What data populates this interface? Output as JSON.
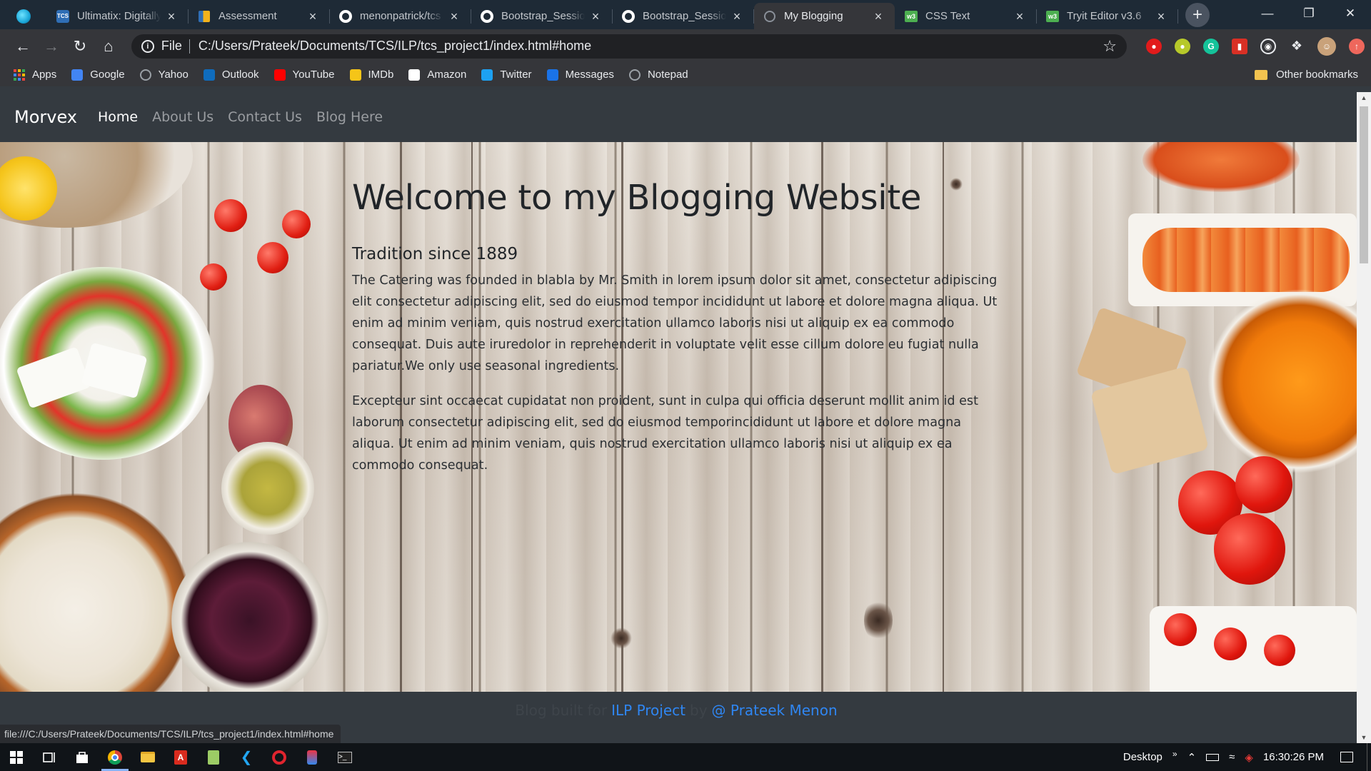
{
  "browser": {
    "tabs": [
      {
        "title": "Ultimatix: Digitally",
        "favicon": "ultimatix-icon",
        "active": false
      },
      {
        "title": "Assessment",
        "favicon": "assessment-icon",
        "active": false
      },
      {
        "title": "menonpatrick/tcs",
        "favicon": "github-icon",
        "active": false
      },
      {
        "title": "Bootstrap_Session",
        "favicon": "github-icon",
        "active": false
      },
      {
        "title": "Bootstrap_Session",
        "favicon": "github-icon",
        "active": false
      },
      {
        "title": "My Blogging",
        "favicon": "globe-icon",
        "active": true
      },
      {
        "title": "CSS Text",
        "favicon": "w3schools-icon",
        "active": false
      },
      {
        "title": "Tryit Editor v3.6",
        "favicon": "w3schools-icon",
        "active": false
      }
    ],
    "address": {
      "scheme_label": "File",
      "url": "C:/Users/Prateek/Documents/TCS/ILP/tcs_project1/index.html#home"
    },
    "bookmarks": [
      {
        "label": "Apps",
        "icon": "apps-grid-icon",
        "color": "#e8453c"
      },
      {
        "label": "Google",
        "icon": "google-icon",
        "color": "#4285f4"
      },
      {
        "label": "Yahoo",
        "icon": "globe-icon",
        "color": "#9aa0a6"
      },
      {
        "label": "Outlook",
        "icon": "outlook-icon",
        "color": "#0f6cbd"
      },
      {
        "label": "YouTube",
        "icon": "youtube-icon",
        "color": "#ff0000"
      },
      {
        "label": "IMDb",
        "icon": "imdb-icon",
        "color": "#f5c518"
      },
      {
        "label": "Amazon",
        "icon": "amazon-icon",
        "color": "#ffffff"
      },
      {
        "label": "Twitter",
        "icon": "twitter-icon",
        "color": "#1da1f2"
      },
      {
        "label": "Messages",
        "icon": "messages-icon",
        "color": "#1a73e8"
      },
      {
        "label": "Notepad",
        "icon": "globe-icon",
        "color": "#9aa0a6"
      }
    ],
    "other_bookmarks": "Other bookmarks",
    "status_url": "file:///C:/Users/Prateek/Documents/TCS/ILP/tcs_project1/index.html#home"
  },
  "site": {
    "brand": "Morvex",
    "nav": [
      {
        "label": "Home",
        "active": true
      },
      {
        "label": "About Us",
        "active": false
      },
      {
        "label": "Contact Us",
        "active": false
      },
      {
        "label": "Blog Here",
        "active": false
      }
    ],
    "heading": "Welcome to my Blogging Website",
    "subheading": "Tradition since 1889",
    "paragraphs": [
      "The Catering was founded in blabla by Mr. Smith in lorem ipsum dolor sit amet, consectetur adipiscing elit consectetur adipiscing elit, sed do eiusmod tempor incididunt ut labore et dolore magna aliqua. Ut enim ad minim veniam, quis nostrud exercitation ullamco laboris nisi ut aliquip ex ea commodo consequat. Duis aute iruredolor in reprehenderit in voluptate velit esse cillum dolore eu fugiat nulla pariatur.We only use seasonal ingredients.",
      "Excepteur sint occaecat cupidatat non proident, sunt in culpa qui officia deserunt mollit anim id est laborum consectetur adipiscing elit, sed do eiusmod temporincididunt ut labore et dolore magna aliqua. Ut enim ad minim veniam, quis nostrud exercitation ullamco laboris nisi ut aliquip ex ea commodo consequat."
    ],
    "footer": {
      "prefix": "Blog built for",
      "project": "ILP Project",
      "middle": "by",
      "author": "@ Prateek Menon"
    }
  },
  "taskbar": {
    "apps": [
      "windows-start-icon",
      "task-view-icon",
      "store-icon",
      "chrome-icon",
      "file-explorer-icon",
      "acrobat-icon",
      "notepad-icon",
      "vscode-icon",
      "opera-icon",
      "snipping-icon",
      "terminal-icon"
    ],
    "desktop_label": "Desktop",
    "time": "16:30:26 PM"
  },
  "colors": {
    "navbar": "#343a40",
    "link": "#2f86f2",
    "active_tab": "#35363a",
    "tab_strip": "#1e2a36"
  }
}
